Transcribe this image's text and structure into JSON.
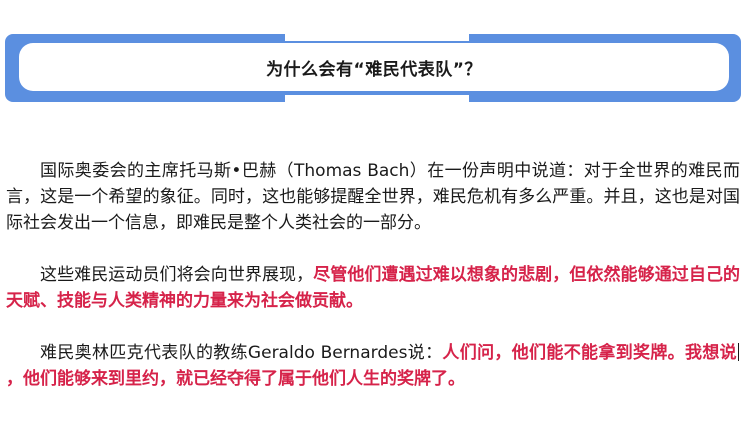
{
  "title": "为什么会有“难民代表队”？",
  "paragraphs": [
    {
      "normal": "国际奥委会的主席托马斯•巴赫（Thomas Bach）在一份声明中说道：对于全世界的难民而言，这是一个希望的象征。同时，这也能够提醒全世界，难民危机有多么严重。并且，这也是对国际社会发出一个信息，即难民是整个人类社会的一部分。"
    },
    {
      "normal": "这些难民运动员们将会向世界展现，",
      "highlight": "尽管他们遭遇过难以想象的悲剧，但依然能够通过自己的天赋、技能与人类精神的力量来为社会做贡献。"
    },
    {
      "normal": "难民奥林匹克代表队的教练Geraldo Bernardes说：",
      "highlight_a": "人们问，他们能不能拿到奖牌。我想说",
      "highlight_b": "，他们能够来到里约，就已经夺得了属于他们人生的奖牌了。"
    }
  ],
  "colors": {
    "frame": "#5b8fe0",
    "highlight": "#d6234a",
    "text": "#1a1a1a"
  }
}
